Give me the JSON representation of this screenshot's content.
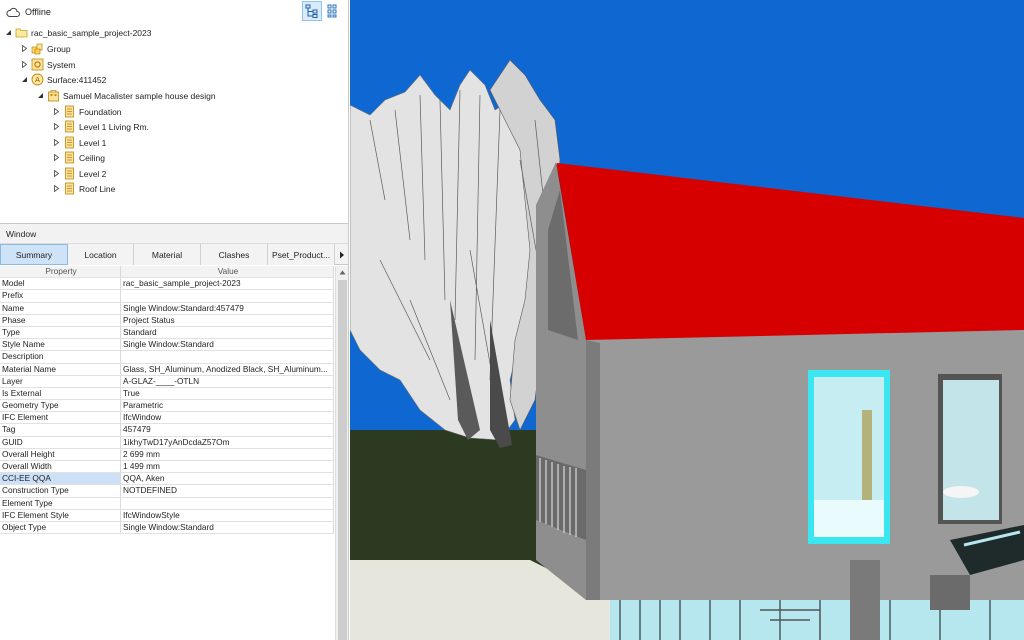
{
  "status": {
    "text": "Offline",
    "icon": "cloud-icon"
  },
  "view_buttons": [
    {
      "icon": "tree-view-icon",
      "active": true
    },
    {
      "icon": "grid-view-icon",
      "active": false
    }
  ],
  "tree": {
    "root": "rac_basic_sample_project-2023",
    "group": "Group",
    "system": "System",
    "surface": "Surface:411452",
    "design": "Samuel Macalister sample house design",
    "levels": [
      "Foundation",
      "Level 1 Living Rm.",
      "Level 1",
      "Ceiling",
      "Level 2",
      "Roof Line"
    ]
  },
  "properties_panel": {
    "title": "Window",
    "tabs": [
      "Summary",
      "Location",
      "Material",
      "Clashes",
      "Pset_Product..."
    ],
    "active_tab": "Summary",
    "columns": [
      "Property",
      "Value"
    ],
    "rows": [
      [
        "Model",
        "rac_basic_sample_project-2023"
      ],
      [
        "Prefix",
        ""
      ],
      [
        "Name",
        "Single Window:Standard:457479"
      ],
      [
        "Phase",
        "Project Status"
      ],
      [
        "Type",
        "Standard"
      ],
      [
        "Style Name",
        "Single Window:Standard"
      ],
      [
        "Description",
        ""
      ],
      [
        "Material Name",
        "Glass, SH_Aluminum, Anodized Black, SH_Aluminum..."
      ],
      [
        "Layer",
        "A-GLAZ-____-OTLN"
      ],
      [
        "Is External",
        "True"
      ],
      [
        "Geometry Type",
        "Parametric"
      ],
      [
        "IFC Element",
        "IfcWindow"
      ],
      [
        "Tag",
        "457479"
      ],
      [
        "GUID",
        "1ikhyTwD17yAnDcdaZ57Om"
      ],
      [
        "Overall Height",
        "2 699 mm"
      ],
      [
        "Overall Width",
        "1 499 mm"
      ],
      [
        "CCI-EE QQA",
        "QQA, Aken"
      ],
      [
        "Construction Type",
        "NOTDEFINED"
      ],
      [
        "Element Type",
        ""
      ],
      [
        "IFC Element Style",
        "IfcWindowStyle"
      ],
      [
        "Object Type",
        "Single Window:Standard"
      ]
    ],
    "selected_row": 16
  },
  "colors": {
    "sky": "#0e66cf",
    "roof": "#d90000",
    "wall": "#9a9a9a",
    "selected_window": "#39e6f0",
    "ground": "#2c3a22",
    "glass": "#b7e7ee"
  }
}
